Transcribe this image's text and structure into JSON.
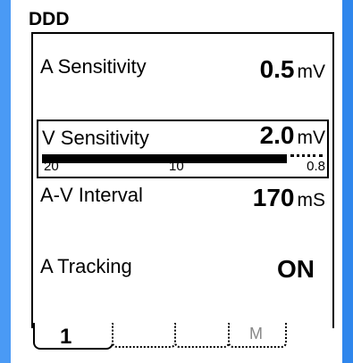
{
  "mode": "DDD",
  "settings": {
    "a_sensitivity": {
      "label": "A Sensitivity",
      "value": "0.5",
      "unit": "mV"
    },
    "v_sensitivity": {
      "label": "V Sensitivity",
      "value": "2.0",
      "unit": "mV",
      "scale": {
        "min_label": "20",
        "mid_label": "10",
        "max_label": "0.8"
      }
    },
    "av_interval": {
      "label": "A-V Interval",
      "value": "170",
      "unit": "mS"
    },
    "a_tracking": {
      "label": "A Tracking",
      "value": "ON"
    }
  },
  "tabs": {
    "tab1": "1",
    "tab4": "M"
  },
  "colors": {
    "frame": "#3b8ff0",
    "panel": "#ffffff",
    "ink": "#000000"
  }
}
